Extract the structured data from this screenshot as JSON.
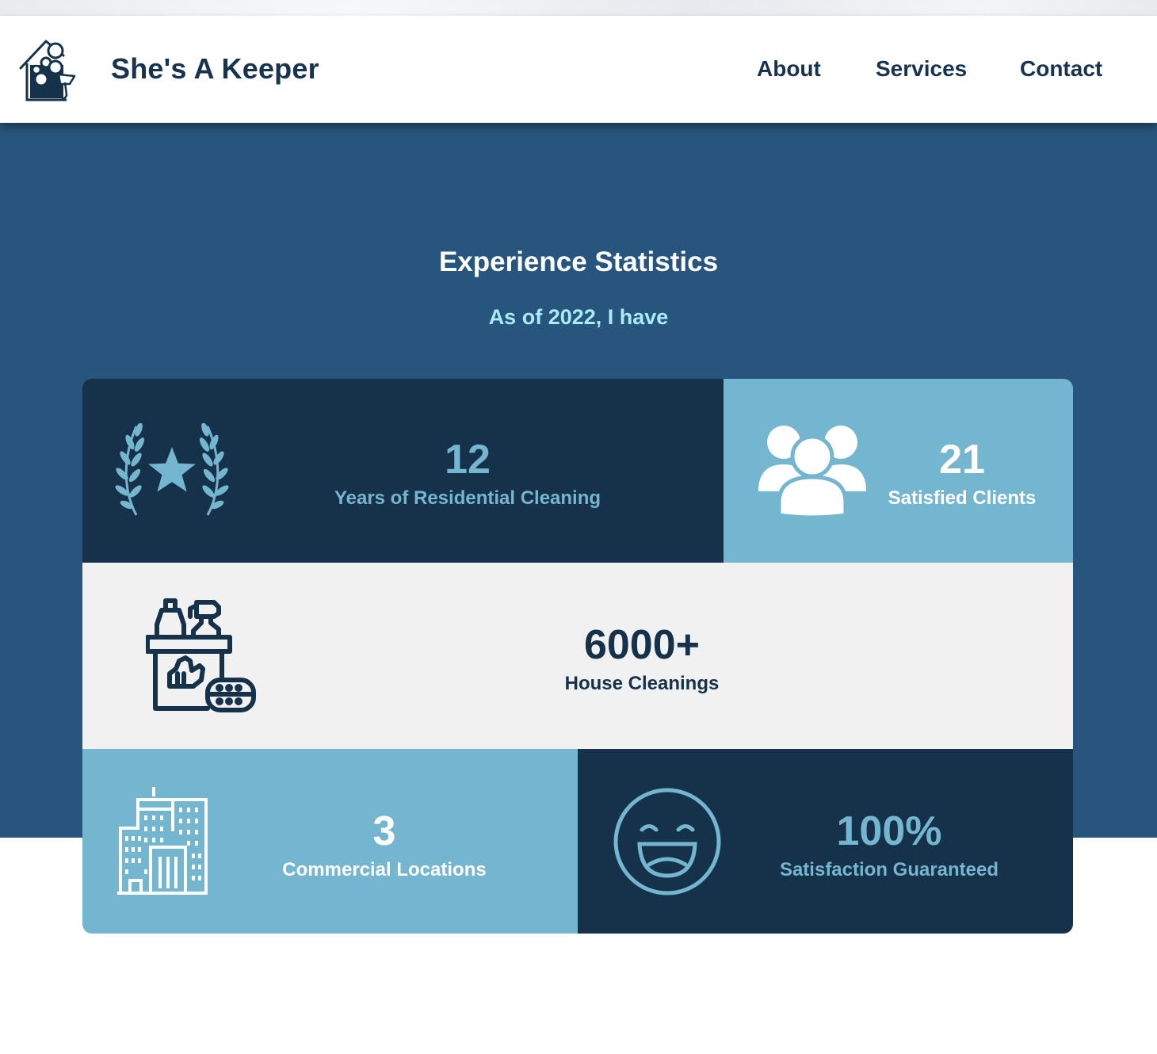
{
  "header": {
    "brand": "She's A Keeper",
    "logo_icon": "house-cleaning-logo-icon",
    "nav": [
      {
        "label": "About"
      },
      {
        "label": "Services"
      },
      {
        "label": "Contact"
      }
    ]
  },
  "section": {
    "title": "Experience Statistics",
    "subtitle": "As of 2022, I have"
  },
  "stats": [
    {
      "value": "12",
      "label": "Years of Residential Cleaning",
      "icon": "laurel-star-icon"
    },
    {
      "value": "21",
      "label": "Satisfied Clients",
      "icon": "people-group-icon"
    },
    {
      "value": "6000+",
      "label": "House Cleanings",
      "icon": "cleaning-supplies-icon"
    },
    {
      "value": "3",
      "label": "Commercial Locations",
      "icon": "buildings-icon"
    },
    {
      "value": "100%",
      "label": "Satisfaction Guaranteed",
      "icon": "laughing-face-icon"
    }
  ],
  "colors": {
    "navy": "#16324a",
    "hero_blue": "#28557e",
    "light_blue": "#74b5cf",
    "pale_cyan": "#a9ecf6",
    "light_gray": "#f1f1f2",
    "brand_text": "#173350"
  }
}
